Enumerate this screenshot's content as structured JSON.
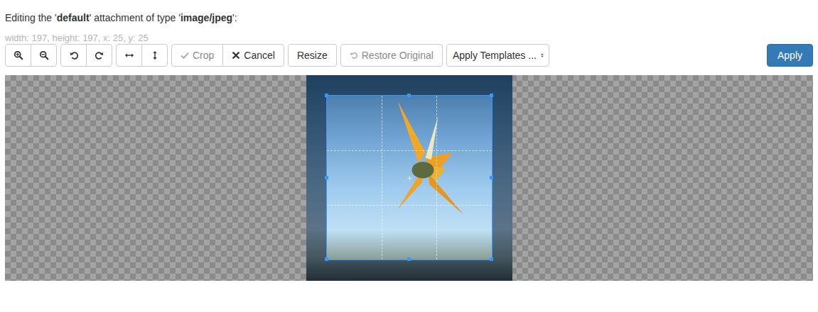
{
  "heading": [
    {
      "text": "Editing the '",
      "bold": false
    },
    {
      "text": "default",
      "bold": true
    },
    {
      "text": "' attachment of type '",
      "bold": false
    },
    {
      "text": "image/jpeg",
      "bold": true
    },
    {
      "text": "':",
      "bold": false
    }
  ],
  "crop_info": "width: 197, height: 197, x: 25, y: 25",
  "toolbar": {
    "crop": {
      "label": "Crop",
      "disabled": true
    },
    "cancel": {
      "label": "Cancel",
      "disabled": false
    },
    "resize": {
      "label": "Resize",
      "disabled": false
    },
    "restore": {
      "label": "Restore Original",
      "disabled": true
    },
    "templates": {
      "placeholder": "Apply Templates ..."
    },
    "apply": {
      "label": "Apply"
    }
  }
}
